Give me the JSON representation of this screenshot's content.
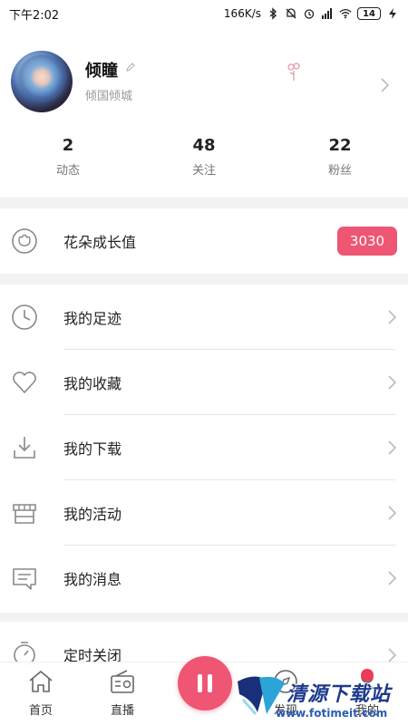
{
  "status_bar": {
    "time": "下午2:02",
    "speed": "166K/s",
    "battery": "14"
  },
  "profile": {
    "name": "倾瞳",
    "subtitle": "倾国倾城",
    "stats": [
      {
        "value": "2",
        "label": "动态"
      },
      {
        "value": "48",
        "label": "关注"
      },
      {
        "value": "22",
        "label": "粉丝"
      }
    ]
  },
  "growth": {
    "label": "花朵成长值",
    "value": "3030"
  },
  "menu": {
    "items": [
      {
        "label": "我的足迹",
        "icon": "clock-icon"
      },
      {
        "label": "我的收藏",
        "icon": "heart-icon"
      },
      {
        "label": "我的下载",
        "icon": "download-icon"
      },
      {
        "label": "我的活动",
        "icon": "store-icon"
      },
      {
        "label": "我的消息",
        "icon": "message-icon"
      }
    ],
    "timer_label": "定时关闭"
  },
  "bottom_nav": {
    "home": "首页",
    "live": "直播",
    "discover": "发现",
    "mine": "我的"
  },
  "watermark": {
    "title": "清源下载站",
    "url": "www.fotimeit.com"
  },
  "colors": {
    "accent": "#ee5674",
    "background": "#f2f2f2"
  }
}
